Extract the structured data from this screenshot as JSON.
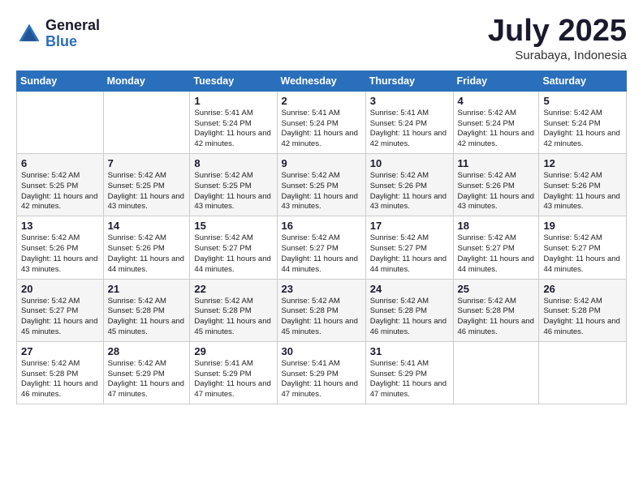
{
  "logo": {
    "general": "General",
    "blue": "Blue"
  },
  "title": "July 2025",
  "subtitle": "Surabaya, Indonesia",
  "weekdays": [
    "Sunday",
    "Monday",
    "Tuesday",
    "Wednesday",
    "Thursday",
    "Friday",
    "Saturday"
  ],
  "weeks": [
    [
      {
        "day": "",
        "info": ""
      },
      {
        "day": "",
        "info": ""
      },
      {
        "day": "1",
        "info": "Sunrise: 5:41 AM\nSunset: 5:24 PM\nDaylight: 11 hours and 42 minutes."
      },
      {
        "day": "2",
        "info": "Sunrise: 5:41 AM\nSunset: 5:24 PM\nDaylight: 11 hours and 42 minutes."
      },
      {
        "day": "3",
        "info": "Sunrise: 5:41 AM\nSunset: 5:24 PM\nDaylight: 11 hours and 42 minutes."
      },
      {
        "day": "4",
        "info": "Sunrise: 5:42 AM\nSunset: 5:24 PM\nDaylight: 11 hours and 42 minutes."
      },
      {
        "day": "5",
        "info": "Sunrise: 5:42 AM\nSunset: 5:24 PM\nDaylight: 11 hours and 42 minutes."
      }
    ],
    [
      {
        "day": "6",
        "info": "Sunrise: 5:42 AM\nSunset: 5:25 PM\nDaylight: 11 hours and 42 minutes."
      },
      {
        "day": "7",
        "info": "Sunrise: 5:42 AM\nSunset: 5:25 PM\nDaylight: 11 hours and 43 minutes."
      },
      {
        "day": "8",
        "info": "Sunrise: 5:42 AM\nSunset: 5:25 PM\nDaylight: 11 hours and 43 minutes."
      },
      {
        "day": "9",
        "info": "Sunrise: 5:42 AM\nSunset: 5:25 PM\nDaylight: 11 hours and 43 minutes."
      },
      {
        "day": "10",
        "info": "Sunrise: 5:42 AM\nSunset: 5:26 PM\nDaylight: 11 hours and 43 minutes."
      },
      {
        "day": "11",
        "info": "Sunrise: 5:42 AM\nSunset: 5:26 PM\nDaylight: 11 hours and 43 minutes."
      },
      {
        "day": "12",
        "info": "Sunrise: 5:42 AM\nSunset: 5:26 PM\nDaylight: 11 hours and 43 minutes."
      }
    ],
    [
      {
        "day": "13",
        "info": "Sunrise: 5:42 AM\nSunset: 5:26 PM\nDaylight: 11 hours and 43 minutes."
      },
      {
        "day": "14",
        "info": "Sunrise: 5:42 AM\nSunset: 5:26 PM\nDaylight: 11 hours and 44 minutes."
      },
      {
        "day": "15",
        "info": "Sunrise: 5:42 AM\nSunset: 5:27 PM\nDaylight: 11 hours and 44 minutes."
      },
      {
        "day": "16",
        "info": "Sunrise: 5:42 AM\nSunset: 5:27 PM\nDaylight: 11 hours and 44 minutes."
      },
      {
        "day": "17",
        "info": "Sunrise: 5:42 AM\nSunset: 5:27 PM\nDaylight: 11 hours and 44 minutes."
      },
      {
        "day": "18",
        "info": "Sunrise: 5:42 AM\nSunset: 5:27 PM\nDaylight: 11 hours and 44 minutes."
      },
      {
        "day": "19",
        "info": "Sunrise: 5:42 AM\nSunset: 5:27 PM\nDaylight: 11 hours and 44 minutes."
      }
    ],
    [
      {
        "day": "20",
        "info": "Sunrise: 5:42 AM\nSunset: 5:27 PM\nDaylight: 11 hours and 45 minutes."
      },
      {
        "day": "21",
        "info": "Sunrise: 5:42 AM\nSunset: 5:28 PM\nDaylight: 11 hours and 45 minutes."
      },
      {
        "day": "22",
        "info": "Sunrise: 5:42 AM\nSunset: 5:28 PM\nDaylight: 11 hours and 45 minutes."
      },
      {
        "day": "23",
        "info": "Sunrise: 5:42 AM\nSunset: 5:28 PM\nDaylight: 11 hours and 45 minutes."
      },
      {
        "day": "24",
        "info": "Sunrise: 5:42 AM\nSunset: 5:28 PM\nDaylight: 11 hours and 46 minutes."
      },
      {
        "day": "25",
        "info": "Sunrise: 5:42 AM\nSunset: 5:28 PM\nDaylight: 11 hours and 46 minutes."
      },
      {
        "day": "26",
        "info": "Sunrise: 5:42 AM\nSunset: 5:28 PM\nDaylight: 11 hours and 46 minutes."
      }
    ],
    [
      {
        "day": "27",
        "info": "Sunrise: 5:42 AM\nSunset: 5:28 PM\nDaylight: 11 hours and 46 minutes."
      },
      {
        "day": "28",
        "info": "Sunrise: 5:42 AM\nSunset: 5:29 PM\nDaylight: 11 hours and 47 minutes."
      },
      {
        "day": "29",
        "info": "Sunrise: 5:41 AM\nSunset: 5:29 PM\nDaylight: 11 hours and 47 minutes."
      },
      {
        "day": "30",
        "info": "Sunrise: 5:41 AM\nSunset: 5:29 PM\nDaylight: 11 hours and 47 minutes."
      },
      {
        "day": "31",
        "info": "Sunrise: 5:41 AM\nSunset: 5:29 PM\nDaylight: 11 hours and 47 minutes."
      },
      {
        "day": "",
        "info": ""
      },
      {
        "day": "",
        "info": ""
      }
    ]
  ]
}
